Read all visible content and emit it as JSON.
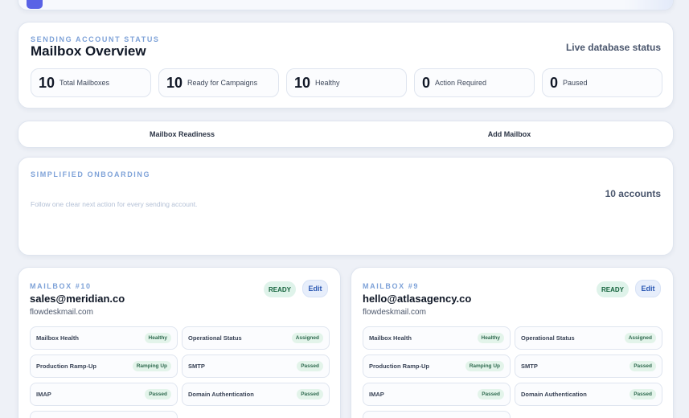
{
  "overview": {
    "eyebrow": "SENDING ACCOUNT STATUS",
    "title": "Mailbox Overview",
    "live_status": "Live database status",
    "stats": [
      {
        "value": "10",
        "label": "Total Mailboxes"
      },
      {
        "value": "10",
        "label": "Ready for Campaigns"
      },
      {
        "value": "10",
        "label": "Healthy"
      },
      {
        "value": "0",
        "label": "Action Required"
      },
      {
        "value": "0",
        "label": "Paused"
      }
    ]
  },
  "tabs": [
    {
      "label": "Mailbox Readiness"
    },
    {
      "label": "Add Mailbox"
    }
  ],
  "onboarding": {
    "eyebrow": "SIMPLIFIED ONBOARDING",
    "description": "Follow one clear next action for every sending account.",
    "count": "10 accounts"
  },
  "mailboxes": [
    {
      "number": "MAILBOX #10",
      "email": "sales@meridian.co",
      "domain": "flowdeskmail.com",
      "status": "READY",
      "edit_label": "Edit",
      "checks": [
        {
          "name": "Mailbox Health",
          "status": "Healthy"
        },
        {
          "name": "Operational Status",
          "status": "Assigned"
        },
        {
          "name": "Production Ramp-Up",
          "status": "Ramping Up"
        },
        {
          "name": "SMTP",
          "status": "Passed"
        },
        {
          "name": "IMAP",
          "status": "Passed"
        },
        {
          "name": "Domain Authentication",
          "status": "Passed"
        }
      ]
    },
    {
      "number": "MAILBOX #9",
      "email": "hello@atlasagency.co",
      "domain": "flowdeskmail.com",
      "status": "READY",
      "edit_label": "Edit",
      "checks": [
        {
          "name": "Mailbox Health",
          "status": "Healthy"
        },
        {
          "name": "Operational Status",
          "status": "Assigned"
        },
        {
          "name": "Production Ramp-Up",
          "status": "Ramping Up"
        },
        {
          "name": "SMTP",
          "status": "Passed"
        },
        {
          "name": "IMAP",
          "status": "Passed"
        },
        {
          "name": "Domain Authentication",
          "status": "Passed"
        }
      ]
    }
  ],
  "colors": {
    "accent": "#5a63e6",
    "eyebrow": "#7ea2d8",
    "ready_bg": "#dff3ea",
    "edit_text": "#2b58b3"
  }
}
